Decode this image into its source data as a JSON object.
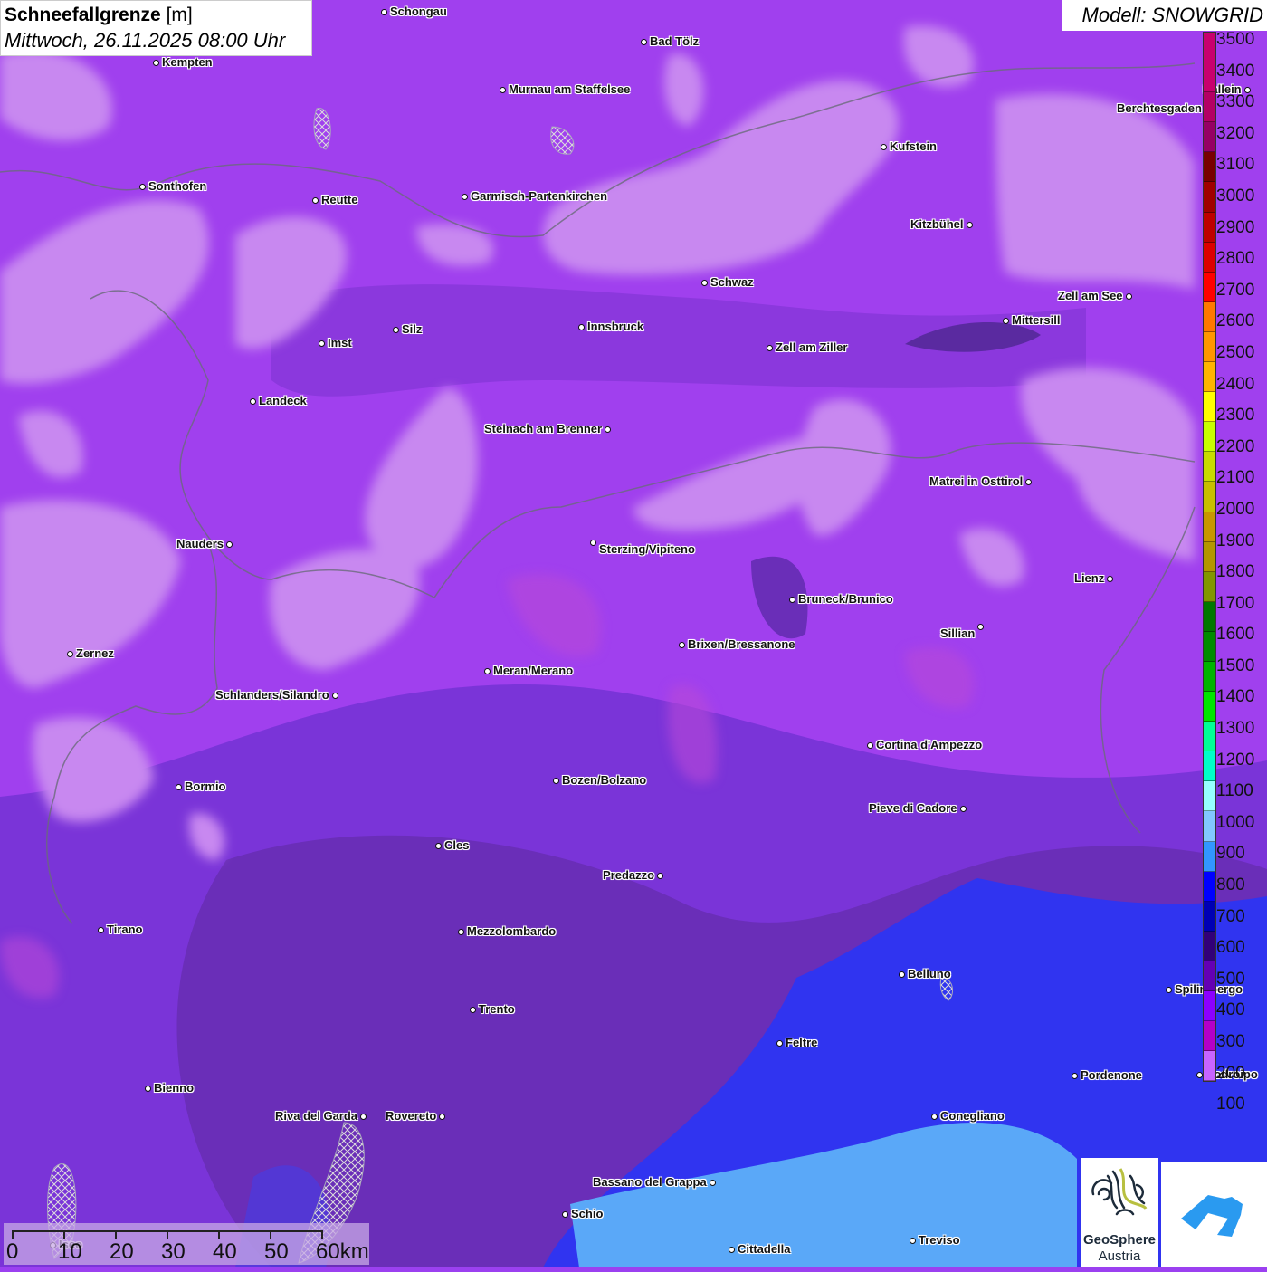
{
  "title": {
    "main": "Schneefallgrenze",
    "unit": "[m]",
    "datetime": "Mittwoch, 26.11.2025 08:00 Uhr"
  },
  "model_label": "Modell: SNOWGRID",
  "legend": {
    "labels": [
      "3500",
      "3400",
      "3300",
      "3200",
      "3100",
      "3000",
      "2900",
      "2800",
      "2700",
      "2600",
      "2500",
      "2400",
      "2300",
      "2200",
      "2100",
      "2000",
      "1900",
      "1800",
      "1700",
      "1600",
      "1500",
      "1400",
      "1300",
      "1200",
      "1100",
      "1000",
      "900",
      "800",
      "700",
      "600",
      "500",
      "400",
      "300",
      "200",
      "100"
    ],
    "colors": [
      "#c8006e",
      "#c8006e",
      "#b40064",
      "#960064",
      "#780000",
      "#a00000",
      "#be0000",
      "#dc0000",
      "#ff0000",
      "#ff7800",
      "#ff9600",
      "#ffb400",
      "#ffff00",
      "#c8ff00",
      "#c8dc00",
      "#c8be00",
      "#c89600",
      "#b49600",
      "#829600",
      "#007800",
      "#008c00",
      "#00b400",
      "#00e600",
      "#00ff96",
      "#00ffc8",
      "#96ffff",
      "#82c8ff",
      "#3296ff",
      "#0000ff",
      "#0000b4",
      "#320078",
      "#6400b4",
      "#8c00ff",
      "#b400c8",
      "#c864ff"
    ]
  },
  "cities": [
    "Schongau",
    "Bad Tölz",
    "Kempten",
    "Murnau am Staffelsee",
    "Hallein",
    "Berchtesgaden",
    "Kufstein",
    "Sonthofen",
    "Reutte",
    "Garmisch-Partenkirchen",
    "Kitzbühel",
    "Schwaz",
    "Zell am See",
    "Mittersill",
    "Innsbruck",
    "Silz",
    "Imst",
    "Zell am Ziller",
    "Landeck",
    "Steinach am Brenner",
    "Matrei in Osttirol",
    "Nauders",
    "Sterzing/Vipiteno",
    "Lienz",
    "Bruneck/Brunico",
    "Sillian",
    "Zernez",
    "Brixen/Bressanone",
    "Meran/Merano",
    "Schlanders/Silandro",
    "Cortina d'Ampezzo",
    "Bozen/Bolzano",
    "Bormio",
    "Pieve di Cadore",
    "Cles",
    "Predazzo",
    "Tirano",
    "Mezzolombardo",
    "Belluno",
    "Spilimbergo",
    "Trento",
    "Feltre",
    "Pordenone",
    "Codroipo",
    "Bienno",
    "Riva del Garda",
    "Rovereto",
    "Conegliano",
    "Bassano del Grappa",
    "Schio",
    "Treviso",
    "Cittadella",
    "Iseo"
  ],
  "scale": {
    "labels": [
      "0",
      "10",
      "20",
      "30",
      "40",
      "50",
      "60km"
    ]
  },
  "logos": {
    "geosphere_line1": "GeoSphere",
    "geosphere_line2": "Austria"
  }
}
